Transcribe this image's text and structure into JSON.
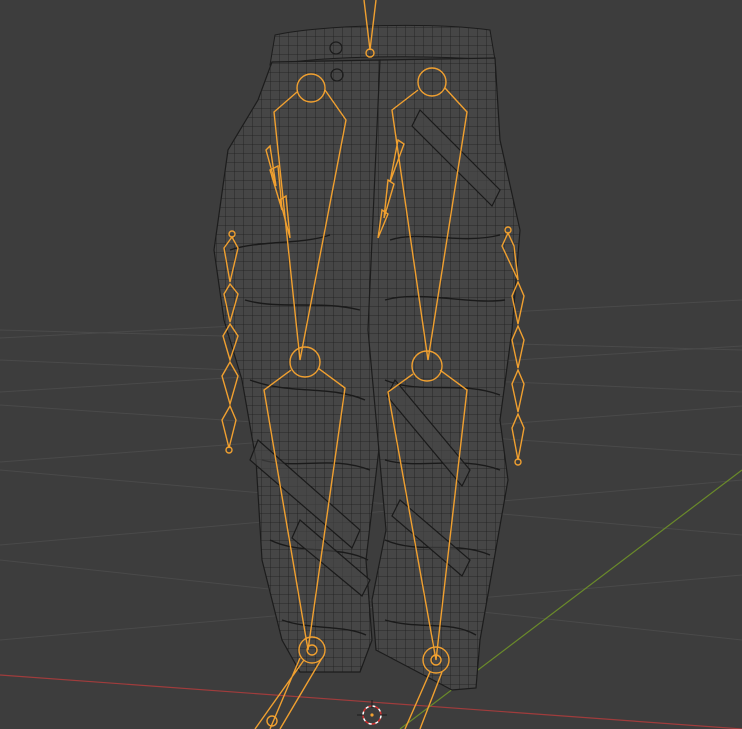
{
  "viewport": {
    "background": "#3d3d3d",
    "grid_color": "#4a4a4a",
    "x_axis_color": "#a03c3c",
    "y_axis_color": "#6a8a2a",
    "mesh_stroke": "#1c1c1c",
    "mesh_fill": "#484848",
    "armature_color": "#f0a030",
    "cursor_red": "#d03030",
    "cursor_white": "#ffffff"
  },
  "objects": {
    "mesh": "pants-mesh",
    "armature": "leg-armature"
  }
}
